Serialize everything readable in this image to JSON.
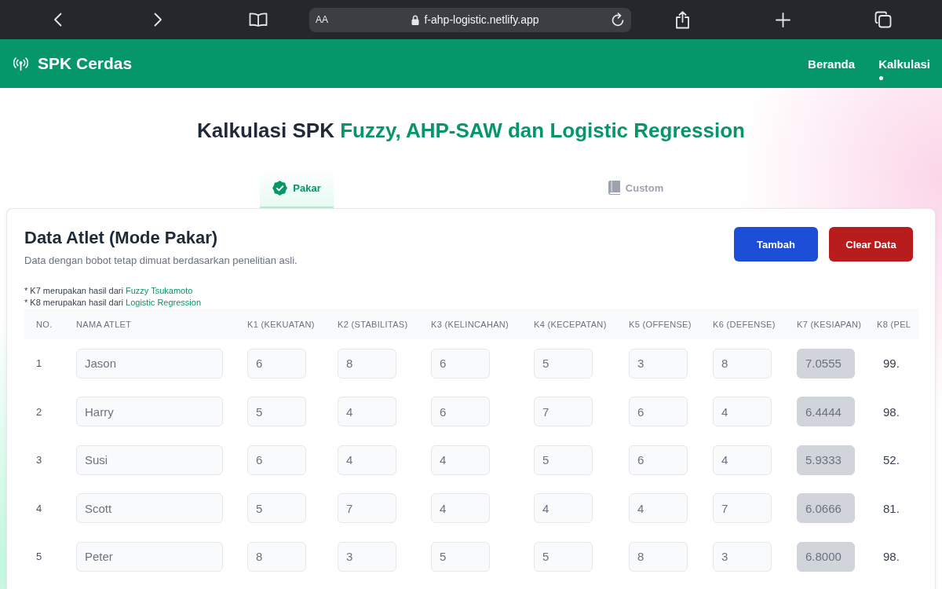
{
  "browser": {
    "text_size_label": "AA",
    "url": "f-ahp-logistic.netlify.app"
  },
  "navbar": {
    "brand": "SPK Cerdas",
    "links": [
      {
        "label": "Beranda",
        "selected": false
      },
      {
        "label": "Kalkulasi",
        "selected": true
      }
    ]
  },
  "page": {
    "title": "Kalkulasi SPK",
    "title_highlight": "Fuzzy, AHP-SAW dan Logistic Regression"
  },
  "tabs": [
    {
      "label": "Pakar",
      "kind": "expert",
      "selected": true
    },
    {
      "label": "Custom",
      "kind": "custom",
      "selected": false
    }
  ],
  "panel": {
    "title": "Data Atlet (Mode Pakar)",
    "subtitle": "Data dengan bobot tetap dimuat berdasarkan penelitian asli.",
    "buttons": [
      {
        "label": "Tambah",
        "kind": "primary"
      },
      {
        "label": "Clear Data",
        "kind": "danger"
      }
    ],
    "notes": [
      {
        "text": "* K7 merupakan hasil dari",
        "link": "Fuzzy Tsukamoto"
      },
      {
        "text": "* K8 merupakan hasil dari",
        "link": "Logistic Regression"
      }
    ]
  },
  "table": {
    "columns": [
      "NO.",
      "NAMA ATLET",
      "K1 (KEKUATAN)",
      "K2 (STABILITAS)",
      "K3 (KELINCAHAN)",
      "K4 (KECEPATAN)",
      "K5 (OFFENSE)",
      "K6 (DEFENSE)",
      "K7 (KESIAPAN)",
      "K8 (PEL"
    ],
    "rows": [
      {
        "no": "1",
        "name": "Jason",
        "scores": [
          "6",
          "8",
          "6",
          "5",
          "3",
          "8"
        ],
        "k7": "7.0555",
        "k8": "99."
      },
      {
        "no": "2",
        "name": "Harry",
        "scores": [
          "5",
          "4",
          "6",
          "7",
          "6",
          "4"
        ],
        "k7": "6.4444",
        "k8": "98."
      },
      {
        "no": "3",
        "name": "Susi",
        "scores": [
          "6",
          "4",
          "4",
          "5",
          "6",
          "4"
        ],
        "k7": "5.9333",
        "k8": "52."
      },
      {
        "no": "4",
        "name": "Scott",
        "scores": [
          "5",
          "7",
          "4",
          "4",
          "4",
          "7"
        ],
        "k7": "6.0666",
        "k8": "81."
      },
      {
        "no": "5",
        "name": "Peter",
        "scores": [
          "8",
          "3",
          "5",
          "5",
          "8",
          "3"
        ],
        "k7": "6.8000",
        "k8": "98."
      }
    ]
  }
}
